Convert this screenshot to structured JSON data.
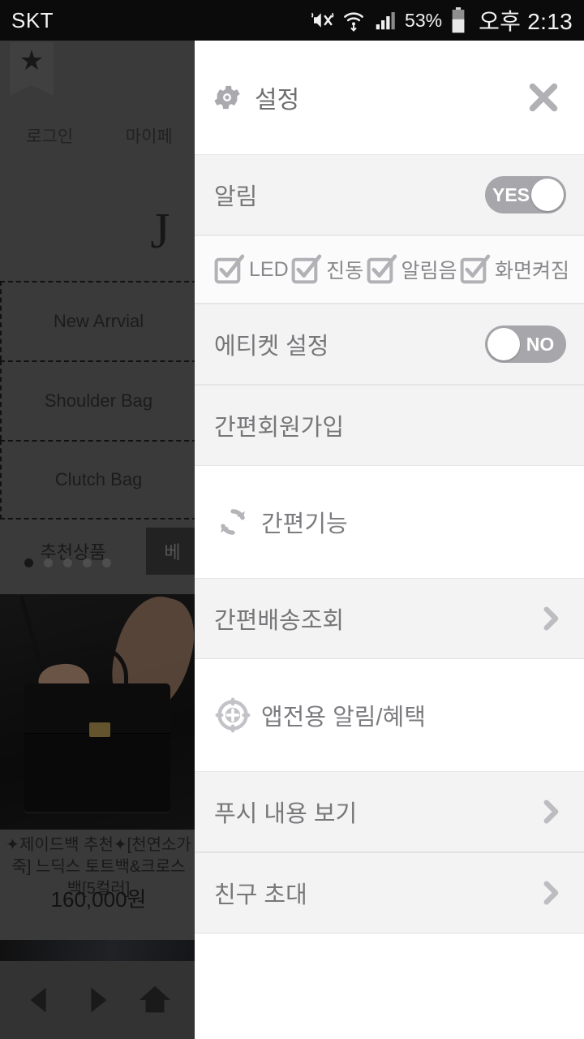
{
  "statusbar": {
    "carrier": "SKT",
    "battery_percent": "53%",
    "time": "오후 2:13",
    "icons": [
      "mute-icon",
      "wifi-icon",
      "signal-icon",
      "battery-icon"
    ]
  },
  "background_app": {
    "bookmark_icon": "star-icon",
    "topnav": [
      "로그인",
      "마이페"
    ],
    "brand_logo": "J",
    "categories": [
      "New Arrvial",
      "Shoulder Bag",
      "Clutch Bag"
    ],
    "tabs": [
      {
        "label": "추천상품",
        "selected": true
      },
      {
        "label": "베",
        "selected": false
      }
    ],
    "carousel_dots": 5,
    "carousel_active_index": 0,
    "product": {
      "title": "✦제이드백 추천✦[천연소가죽] 느딕스 토트백&크로스백[5컬러]",
      "price": "160,000원"
    },
    "navbar": [
      "back-icon",
      "forward-icon",
      "home-icon"
    ]
  },
  "panel": {
    "header": {
      "icon": "gear-icon",
      "title": "설정",
      "close_icon": "close-icon"
    },
    "notification_row": {
      "label": "알림",
      "toggle_state": "on",
      "toggle_label": "YES"
    },
    "checkboxes": [
      {
        "label": "LED",
        "checked": true
      },
      {
        "label": "진동",
        "checked": true
      },
      {
        "label": "알림음",
        "checked": true
      },
      {
        "label": "화면켜짐",
        "checked": true
      }
    ],
    "etiquette_row": {
      "label": "에티켓 설정",
      "toggle_state": "off",
      "toggle_label": "NO"
    },
    "signup_row": {
      "label": "간편회원가입"
    },
    "section_easy": {
      "icon": "refresh-icon",
      "title": "간편기능"
    },
    "delivery_row": {
      "label": "간편배송조회",
      "chevron": "chevron-right-icon"
    },
    "section_app": {
      "icon": "target-plus-icon",
      "title": "앱전용 알림/혜택"
    },
    "push_row": {
      "label": "푸시 내용 보기",
      "chevron": "chevron-right-icon"
    },
    "invite_row": {
      "label": "친구 초대",
      "chevron": "chevron-right-icon"
    }
  },
  "colors": {
    "panel_bg": "#fbfbfb",
    "row_band": "#f3f3f3",
    "text_gray": "#77777a",
    "toggle_gray": "#a6a6ab",
    "statusbar_bg": "#0b0b0b"
  }
}
